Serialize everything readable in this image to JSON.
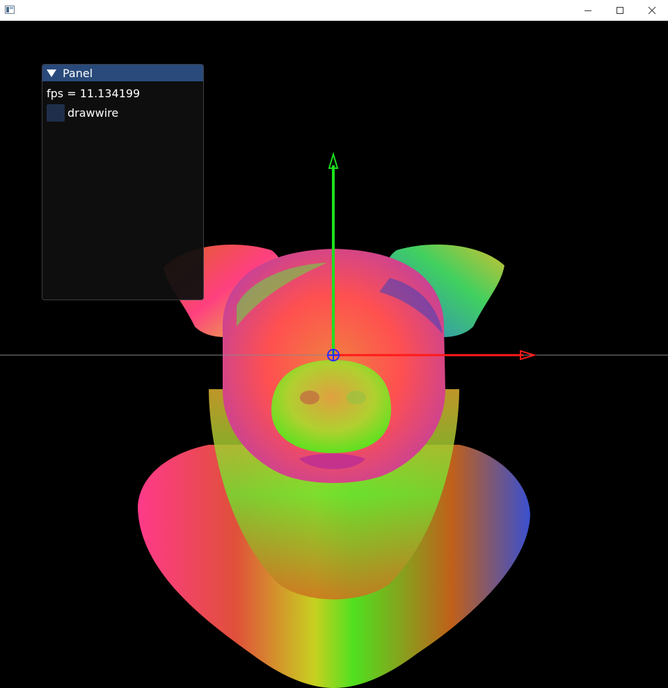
{
  "panel": {
    "title": "Panel",
    "fps_text": "fps = 11.134199",
    "drawwire": {
      "label": "drawwire",
      "checked": false
    }
  },
  "gizmo": {
    "x_axis_color": "#ff1a1a",
    "y_axis_color": "#1ee01e",
    "z_axis_color": "#2b2bff"
  },
  "scene": {
    "background": "#000000",
    "model": "pig-head"
  }
}
